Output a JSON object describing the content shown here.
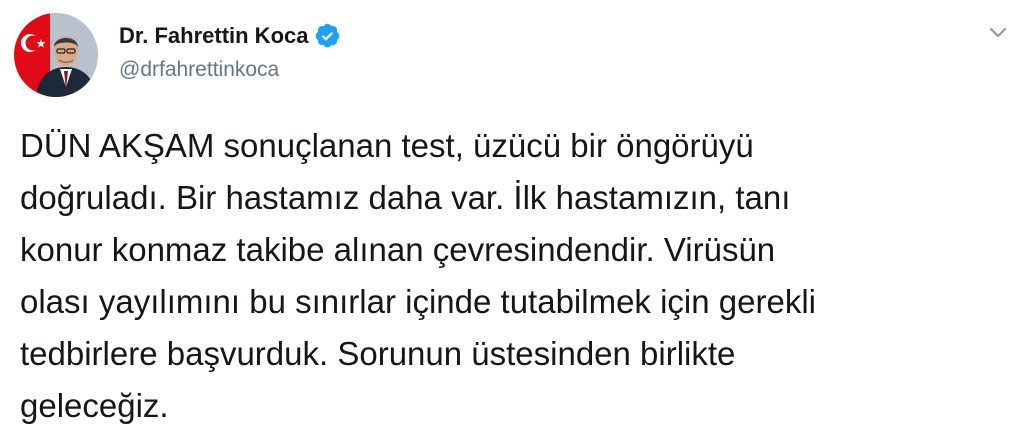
{
  "tweet": {
    "author": {
      "display_name": "Dr. Fahrettin Koca",
      "handle": "@drfahrettinkoca",
      "verified": true
    },
    "text_lines": [
      "DÜN AKŞAM sonuçlanan test, üzücü bir öngörüyü",
      "doğruladı. Bir hastamız daha var. İlk hastamızın, tanı",
      "konur konmaz takibe alınan çevresindendir. Virüsün",
      "olası yayılımını bu sınırlar içinde tutabilmek için gerekli",
      "tedbirlere başvurduk. Sorunun üstesinden birlikte",
      "geleceğiz."
    ]
  },
  "icons": {
    "verified": "verified-badge-icon",
    "menu": "chevron-down-icon",
    "avatar": "profile-photo"
  },
  "colors": {
    "text": "#14171a",
    "secondary_text": "#657786",
    "verified_blue": "#1da1f2",
    "flag_red": "#e30a17"
  }
}
